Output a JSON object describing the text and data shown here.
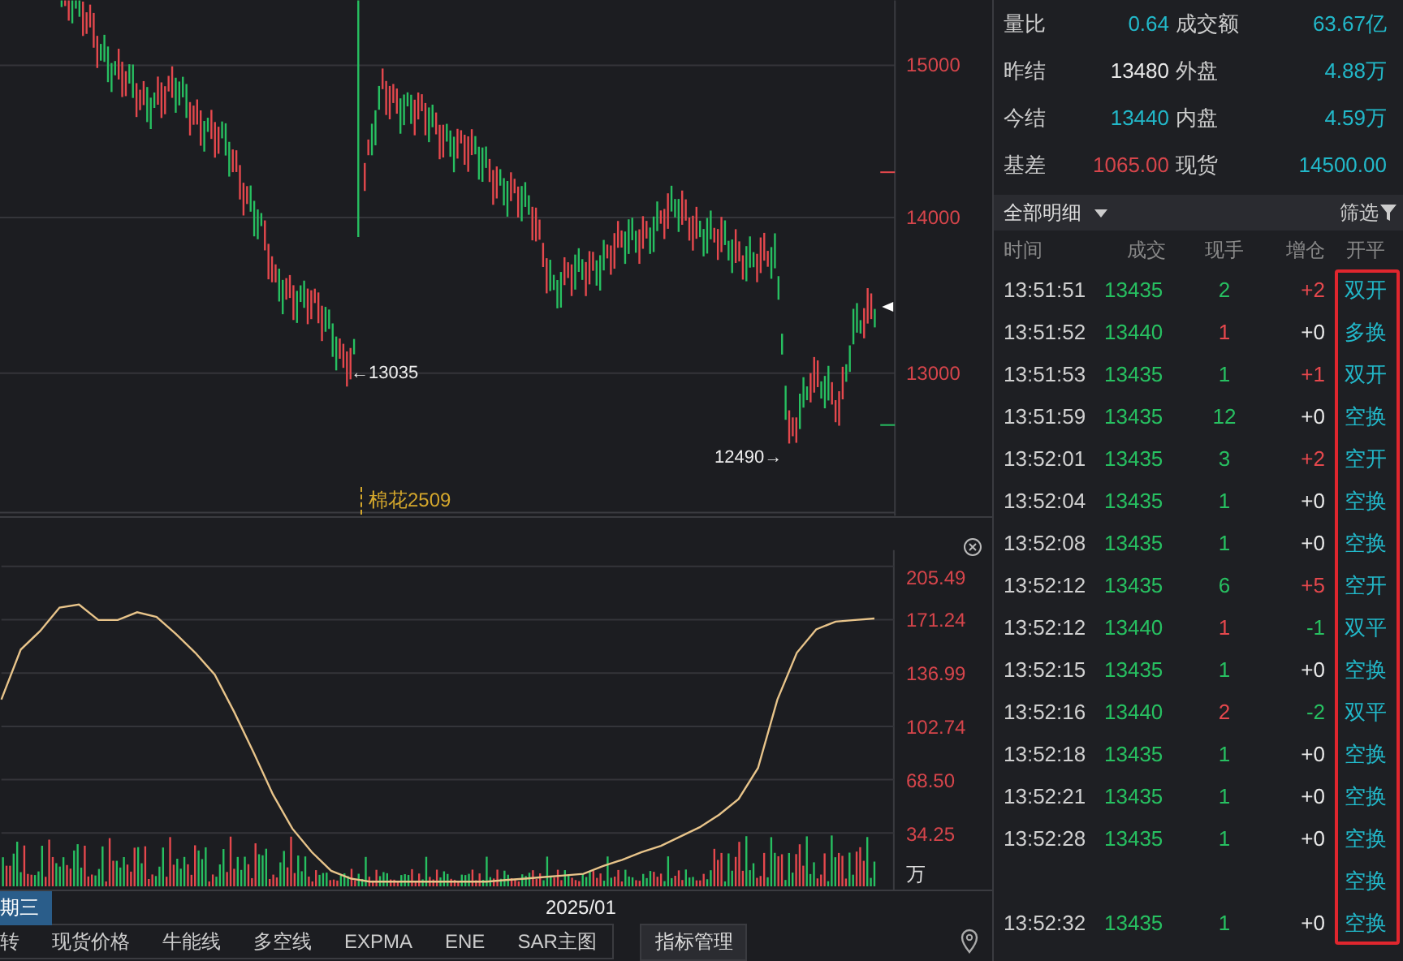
{
  "price_chart": {
    "axis_labels": [
      "15000",
      "14000",
      "13000"
    ],
    "low_markers": [
      "←13035",
      "12490→"
    ],
    "contract_label": "棉花2509"
  },
  "indicator_chart": {
    "unit": "万",
    "chart_data": {
      "type": "line",
      "grid": true,
      "ylim": [
        0,
        205.49
      ],
      "yticks": [
        {
          "value": 205.49,
          "label": "205.49"
        },
        {
          "value": 171.24,
          "label": "171.24"
        },
        {
          "value": 136.99,
          "label": "136.99"
        },
        {
          "value": 102.74,
          "label": "102.74"
        },
        {
          "value": 68.5,
          "label": "68.50"
        },
        {
          "value": 34.25,
          "label": "34.25"
        }
      ],
      "series": [
        {
          "color": "#e8c48a",
          "values": [
            120,
            152,
            164,
            179,
            181,
            171,
            171,
            176,
            173,
            162,
            150,
            136,
            112,
            86,
            59,
            37,
            22,
            10,
            5,
            3,
            3,
            3,
            3,
            3,
            3,
            3,
            4,
            5,
            6,
            7,
            8,
            13,
            17,
            22,
            26,
            32,
            38,
            46,
            56,
            76,
            120,
            150,
            165,
            170,
            171,
            172
          ]
        }
      ]
    }
  },
  "date_axis": {
    "cursor_label": "期三",
    "tick_label": "2025/01"
  },
  "indicator_tabs": [
    "转",
    "现货价格",
    "牛能线",
    "多空线",
    "EXPMA",
    "ENE",
    "SAR主图"
  ],
  "manage_button": "指标管理",
  "stats": [
    {
      "label": "量比",
      "value": "0.64",
      "color": "#22b8c9"
    },
    {
      "label": "成交额",
      "value": "63.67亿",
      "color": "#22b8c9"
    },
    {
      "label": "昨结",
      "value": "13480",
      "color": "#e8e8e8"
    },
    {
      "label": "外盘",
      "value": "4.88万",
      "color": "#22b8c9"
    },
    {
      "label": "今结",
      "value": "13440",
      "color": "#22b8c9"
    },
    {
      "label": "内盘",
      "value": "4.59万",
      "color": "#22b8c9"
    },
    {
      "label": "基差",
      "value": "1065.00",
      "color": "#d6454b"
    },
    {
      "label": "现货",
      "value": "14500.00",
      "color": "#22b8c9"
    }
  ],
  "detail_bar": {
    "title": "全部明细",
    "filter": "筛选"
  },
  "trades": {
    "columns": [
      "时间",
      "成交",
      "现手",
      "增仓",
      "开平"
    ],
    "action_column_highlighted": true,
    "rows": [
      {
        "time": "13:51:51",
        "price": "13435",
        "qty": {
          "text": "2",
          "color": "#27c061"
        },
        "delta": {
          "text": "+2",
          "color": "#e5484d"
        },
        "action": "双开"
      },
      {
        "time": "13:51:52",
        "price": "13440",
        "qty": {
          "text": "1",
          "color": "#e5484d"
        },
        "delta": {
          "text": "+0",
          "color": "#e8e8e8"
        },
        "action": "多换"
      },
      {
        "time": "13:51:53",
        "price": "13435",
        "qty": {
          "text": "1",
          "color": "#27c061"
        },
        "delta": {
          "text": "+1",
          "color": "#e5484d"
        },
        "action": "双开"
      },
      {
        "time": "13:51:59",
        "price": "13435",
        "qty": {
          "text": "12",
          "color": "#27c061"
        },
        "delta": {
          "text": "+0",
          "color": "#e8e8e8"
        },
        "action": "空换"
      },
      {
        "time": "13:52:01",
        "price": "13435",
        "qty": {
          "text": "3",
          "color": "#27c061"
        },
        "delta": {
          "text": "+2",
          "color": "#e5484d"
        },
        "action": "空开"
      },
      {
        "time": "13:52:04",
        "price": "13435",
        "qty": {
          "text": "1",
          "color": "#27c061"
        },
        "delta": {
          "text": "+0",
          "color": "#e8e8e8"
        },
        "action": "空换"
      },
      {
        "time": "13:52:08",
        "price": "13435",
        "qty": {
          "text": "1",
          "color": "#27c061"
        },
        "delta": {
          "text": "+0",
          "color": "#e8e8e8"
        },
        "action": "空换"
      },
      {
        "time": "13:52:12",
        "price": "13435",
        "qty": {
          "text": "6",
          "color": "#27c061"
        },
        "delta": {
          "text": "+5",
          "color": "#e5484d"
        },
        "action": "空开"
      },
      {
        "time": "13:52:12",
        "price": "13440",
        "qty": {
          "text": "1",
          "color": "#e5484d"
        },
        "delta": {
          "text": "-1",
          "color": "#27c061"
        },
        "action": "双平"
      },
      {
        "time": "13:52:15",
        "price": "13435",
        "qty": {
          "text": "1",
          "color": "#27c061"
        },
        "delta": {
          "text": "+0",
          "color": "#e8e8e8"
        },
        "action": "空换"
      },
      {
        "time": "13:52:16",
        "price": "13440",
        "qty": {
          "text": "2",
          "color": "#e5484d"
        },
        "delta": {
          "text": "-2",
          "color": "#27c061"
        },
        "action": "双平"
      },
      {
        "time": "13:52:18",
        "price": "13435",
        "qty": {
          "text": "1",
          "color": "#27c061"
        },
        "delta": {
          "text": "+0",
          "color": "#e8e8e8"
        },
        "action": "空换"
      },
      {
        "time": "13:52:21",
        "price": "13435",
        "qty": {
          "text": "1",
          "color": "#27c061"
        },
        "delta": {
          "text": "+0",
          "color": "#e8e8e8"
        },
        "action": "空换"
      },
      {
        "time": "13:52:28",
        "price": "13435",
        "qty": {
          "text": "1",
          "color": "#27c061"
        },
        "delta": {
          "text": "+0",
          "color": "#e8e8e8"
        },
        "action": "空换"
      },
      {
        "action": "空换"
      },
      {
        "time": "13:52:32",
        "price": "13435",
        "qty": {
          "text": "1",
          "color": "#27c061"
        },
        "delta": {
          "text": "+0",
          "color": "#e8e8e8"
        },
        "action": "空换"
      }
    ]
  }
}
